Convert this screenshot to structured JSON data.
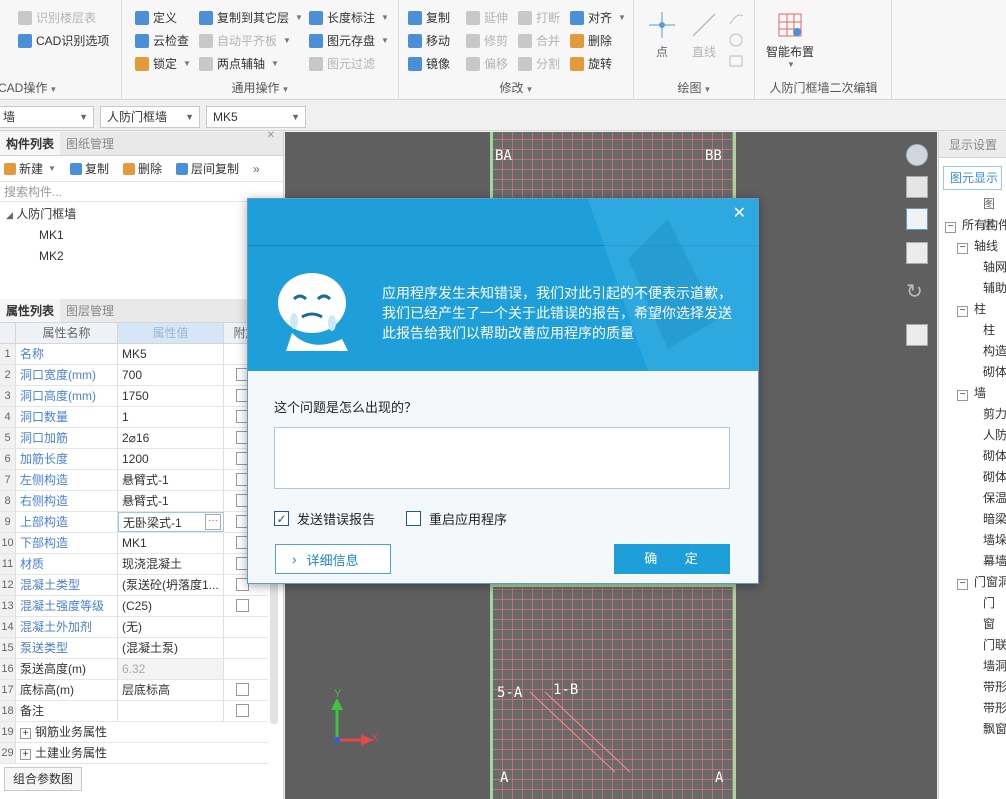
{
  "ribbon": {
    "cad_group": {
      "title": "CAD操作",
      "items": [
        "识别楼层表",
        "CAD识别选项"
      ]
    },
    "general_group": {
      "title": "通用操作",
      "col1": [
        "定义",
        "云检查",
        "锁定"
      ],
      "col2": [
        "复制到其它层",
        "自动平齐板",
        "两点辅轴"
      ],
      "col3": [
        "长度标注",
        "图元存盘",
        "图元过滤"
      ]
    },
    "modify_group": {
      "title": "修改",
      "col1": [
        "复制",
        "移动",
        "镜像"
      ],
      "col2": [
        "延伸",
        "修剪",
        "偏移"
      ],
      "col3": [
        "打断",
        "合并",
        "分割"
      ],
      "col4": [
        "对齐",
        "删除",
        "旋转"
      ]
    },
    "draw_group": {
      "title": "绘图",
      "point": "点",
      "line": "直线"
    },
    "smart_group": {
      "title": "人防门框墙二次编辑",
      "smart_layout": "智能布置"
    }
  },
  "selectors": {
    "floor": "墙",
    "type": "人防门框墙",
    "component": "MK5"
  },
  "component_panel": {
    "tabs": [
      "构件列表",
      "图纸管理"
    ],
    "toolbar": [
      "新建",
      "复制",
      "删除",
      "层间复制"
    ],
    "search_placeholder": "搜索构件...",
    "tree_root": "人防门框墙",
    "tree_items": [
      "MK1",
      "MK2"
    ]
  },
  "property_panel": {
    "tabs": [
      "属性列表",
      "图层管理"
    ],
    "headers": {
      "name": "属性名称",
      "value": "属性值",
      "extra": "附加"
    },
    "rows": [
      {
        "n": "1",
        "name": "名称",
        "value": "MK5"
      },
      {
        "n": "2",
        "name": "洞口宽度(mm)",
        "value": "700"
      },
      {
        "n": "3",
        "name": "洞口高度(mm)",
        "value": "1750"
      },
      {
        "n": "4",
        "name": "洞口数量",
        "value": "1"
      },
      {
        "n": "5",
        "name": "洞口加筋",
        "value": "2⌀16"
      },
      {
        "n": "6",
        "name": "加筋长度",
        "value": "1200"
      },
      {
        "n": "7",
        "name": "左侧构造",
        "value": "悬臂式-1"
      },
      {
        "n": "8",
        "name": "右侧构造",
        "value": "悬臂式-1"
      },
      {
        "n": "9",
        "name": "上部构造",
        "value": "无卧梁式-1"
      },
      {
        "n": "10",
        "name": "下部构造",
        "value": "MK1"
      },
      {
        "n": "11",
        "name": "材质",
        "value": "现浇混凝土"
      },
      {
        "n": "12",
        "name": "混凝土类型",
        "value": "(泵送砼(坍落度1..."
      },
      {
        "n": "13",
        "name": "混凝土强度等级",
        "value": "(C25)"
      },
      {
        "n": "14",
        "name": "混凝土外加剂",
        "value": "(无)"
      },
      {
        "n": "15",
        "name": "泵送类型",
        "value": "(混凝土泵)"
      },
      {
        "n": "16",
        "name": "泵送高度(m)",
        "value": "6.32"
      },
      {
        "n": "17",
        "name": "底标高(m)",
        "value": "层底标高"
      },
      {
        "n": "18",
        "name": "备注",
        "value": ""
      },
      {
        "n": "19",
        "name": "钢筋业务属性",
        "value": ""
      },
      {
        "n": "29",
        "name": "土建业务属性",
        "value": ""
      }
    ],
    "bottom_button": "组合参数图"
  },
  "display_panel": {
    "title": "显示设置",
    "tab": "图元显示",
    "col_header": "图层",
    "items": [
      "所有构件",
      "轴线",
      "轴网",
      "辅助",
      "柱",
      "柱",
      "构造",
      "砌体",
      "墙",
      "剪力",
      "人防",
      "砌体",
      "砌体",
      "保温",
      "暗梁",
      "墙垛",
      "幕墙",
      "门窗洞",
      "门",
      "窗",
      "门联",
      "墙洞",
      "带形",
      "带形",
      "飘窗"
    ]
  },
  "dialog": {
    "message": "应用程序发生未知错误，我们对此引起的不便表示道歉，我们已经产生了一个关于此错误的报告，希望你选择发送此报告给我们以帮助改善应用程序的质量",
    "question": "这个问题是怎么出现的？",
    "checkbox_send": "发送错误报告",
    "checkbox_send_checked": true,
    "checkbox_restart": "重启应用程序",
    "checkbox_restart_checked": false,
    "details_button": "详细信息",
    "ok_button": "确 定"
  },
  "axis": {
    "x": "X",
    "y": "Y"
  },
  "colors": {
    "accent": "#1e9fd9",
    "link_blue": "#4a7fd8",
    "canvas_bg": "#5f5f5f",
    "grid_red": "#ff7878",
    "outline_green": "#9fd9a0"
  }
}
